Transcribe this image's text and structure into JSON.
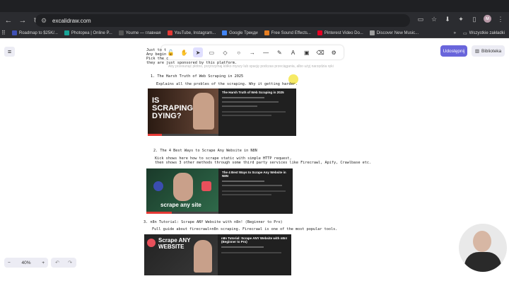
{
  "browser": {
    "url": "excalidraw.com",
    "bookmarks": [
      {
        "label": "Roadmap to $25K/...",
        "color": "#3f51b5"
      },
      {
        "label": "Photopea | Online P...",
        "color": "#18a497"
      },
      {
        "label": "Youme — главная",
        "color": "#555555"
      },
      {
        "label": "YouTube, Instagram...",
        "color": "#e53935"
      },
      {
        "label": "Google Трекди",
        "color": "#4285f4"
      },
      {
        "label": "Free Sound Effects...",
        "color": "#e67e22"
      },
      {
        "label": "Pinterest Video Do...",
        "color": "#e60023"
      },
      {
        "label": "Discover New Music...",
        "color": "#9e9e9e"
      }
    ],
    "bookmarks_more": "»",
    "all_bookmarks": "Wszystkie zakładki",
    "avatar_letter": "м"
  },
  "excalidraw": {
    "share_label": "Udostępnij",
    "library_label": "Biblioteka",
    "zoom_level": "40%",
    "zoom_minus": "−",
    "zoom_plus": "+",
    "undo": "↶",
    "redo": "↷",
    "hint_text": "Aby przesunąć płótno, przytrzymaj kółko myszy lub spację podczas przeciągania, albo użyj narzędzia ręki",
    "tools": [
      {
        "name": "lock-icon",
        "glyph": "🔓"
      },
      {
        "name": "hand-icon",
        "glyph": "✋"
      },
      {
        "name": "select-icon",
        "glyph": "➤",
        "active": true
      },
      {
        "name": "rectangle-icon",
        "glyph": "▭"
      },
      {
        "name": "diamond-icon",
        "glyph": "◇"
      },
      {
        "name": "ellipse-icon",
        "glyph": "○"
      },
      {
        "name": "arrow-icon",
        "glyph": "→"
      },
      {
        "name": "line-icon",
        "glyph": "—"
      },
      {
        "name": "pencil-icon",
        "glyph": "✎"
      },
      {
        "name": "text-icon",
        "glyph": "A"
      },
      {
        "name": "image-icon",
        "glyph": "▣"
      },
      {
        "name": "eraser-icon",
        "glyph": "⌫"
      },
      {
        "name": "more-tools-icon",
        "glyph": "⚙"
      }
    ]
  },
  "notes": {
    "intro_lines": [
      "Just to t",
      "Any begin",
      "Pick the c",
      "they are just sponsored by this platform."
    ],
    "items": [
      {
        "heading": "1. The Harsh Truth of Web Scraping in 2025",
        "desc": [
          "Explains all the probles of the scraping. Why it getting harder."
        ],
        "thumb_text": "IS SCRAPING DYING?",
        "panel_title": "The Harsh Truth of Web Scraping in 2025"
      },
      {
        "heading": "2. The 4 Best Ways to Scrape Any Website in N8N",
        "desc": [
          "Kick shows here how to scrape static with simple HTTP request,",
          "then shows 3 other methods through some third party services like Firecrawl, Apify, Crawlbase etc."
        ],
        "thumb_text": "scrape any site",
        "panel_title": "The 4 Best Ways to Scrape Any Website in N8N"
      },
      {
        "heading": "3. n8n Tutorial: Scrape ANY Website with n8n! (Beginner to Pro)",
        "desc": [
          "Full guide about firecrawl+n8n scraping. Firecrawl is one of the most popular tools."
        ],
        "thumb_text": "Scrape ANY WEBSITE",
        "panel_title": "n8n Tutorial: Scrape ANY Website with n8n! (Beginner to Pro)"
      }
    ]
  }
}
